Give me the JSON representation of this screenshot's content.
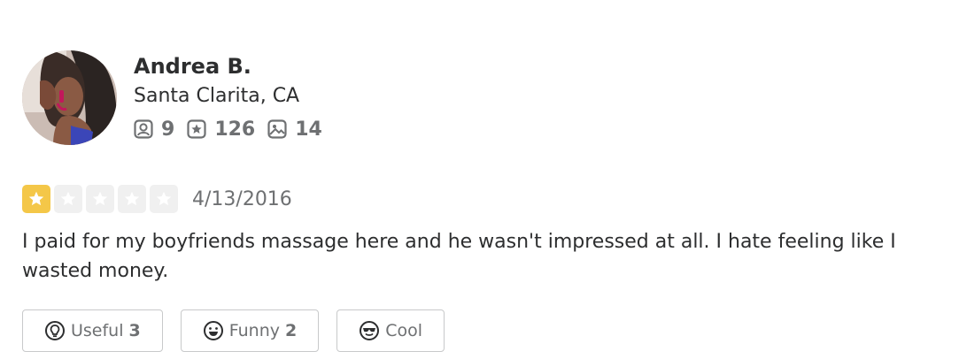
{
  "reviewer": {
    "name": "Andrea B.",
    "location": "Santa Clarita, CA",
    "stats": {
      "friends": "9",
      "reviews": "126",
      "photos": "14"
    }
  },
  "review": {
    "rating": 1,
    "rating_max": 5,
    "date": "4/13/2016",
    "text": "I paid for my boyfriends massage here and he wasn't impressed at all. I hate feeling like I wasted money."
  },
  "actions": {
    "useful": {
      "label": "Useful",
      "count": "3"
    },
    "funny": {
      "label": "Funny",
      "count": "2"
    },
    "cool": {
      "label": "Cool"
    }
  },
  "colors": {
    "star_filled": "#f4c748",
    "star_empty": "#f0f0f0",
    "text_primary": "#2d2e2f",
    "text_secondary": "#6e7072",
    "button_border": "#c8c9ca"
  },
  "icons": {
    "friends": "friends-icon",
    "reviews": "review-star-icon",
    "photos": "photo-icon",
    "useful": "lightbulb-icon",
    "funny": "smile-icon",
    "cool": "sunglasses-icon"
  }
}
